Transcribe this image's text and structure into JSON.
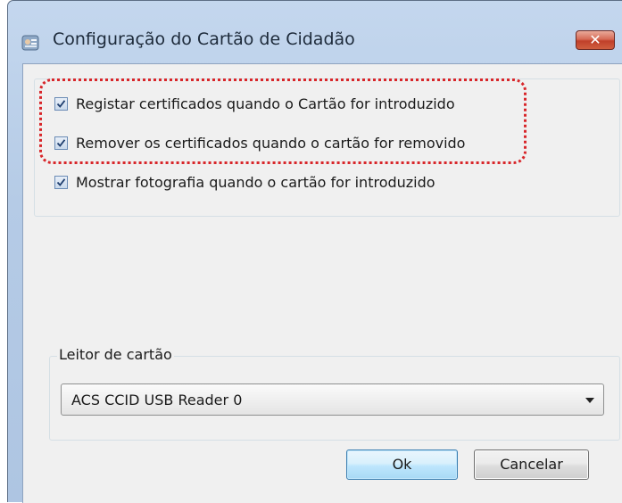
{
  "window": {
    "title": "Configuração do Cartão de Cidadão",
    "close_glyph": "✕"
  },
  "options": [
    {
      "label": "Registar certificados quando o Cartão for introduzido",
      "checked": true
    },
    {
      "label": "Remover os certificados quando o cartão for removido",
      "checked": true
    },
    {
      "label": "Mostrar fotografia quando o cartão for introduzido",
      "checked": true
    }
  ],
  "reader": {
    "group_label": "Leitor de cartão",
    "selected": "ACS CCID USB Reader 0"
  },
  "buttons": {
    "ok_label": "Ok",
    "cancel_label": "Cancelar"
  },
  "icons": {
    "app": "id-card-icon",
    "close": "close-icon",
    "check": "checkmark-icon",
    "dropdown": "chevron-down-icon"
  },
  "colors": {
    "highlight": "#d8262a",
    "close_button": "#c0402a",
    "default_button": "#3c7fb1"
  }
}
